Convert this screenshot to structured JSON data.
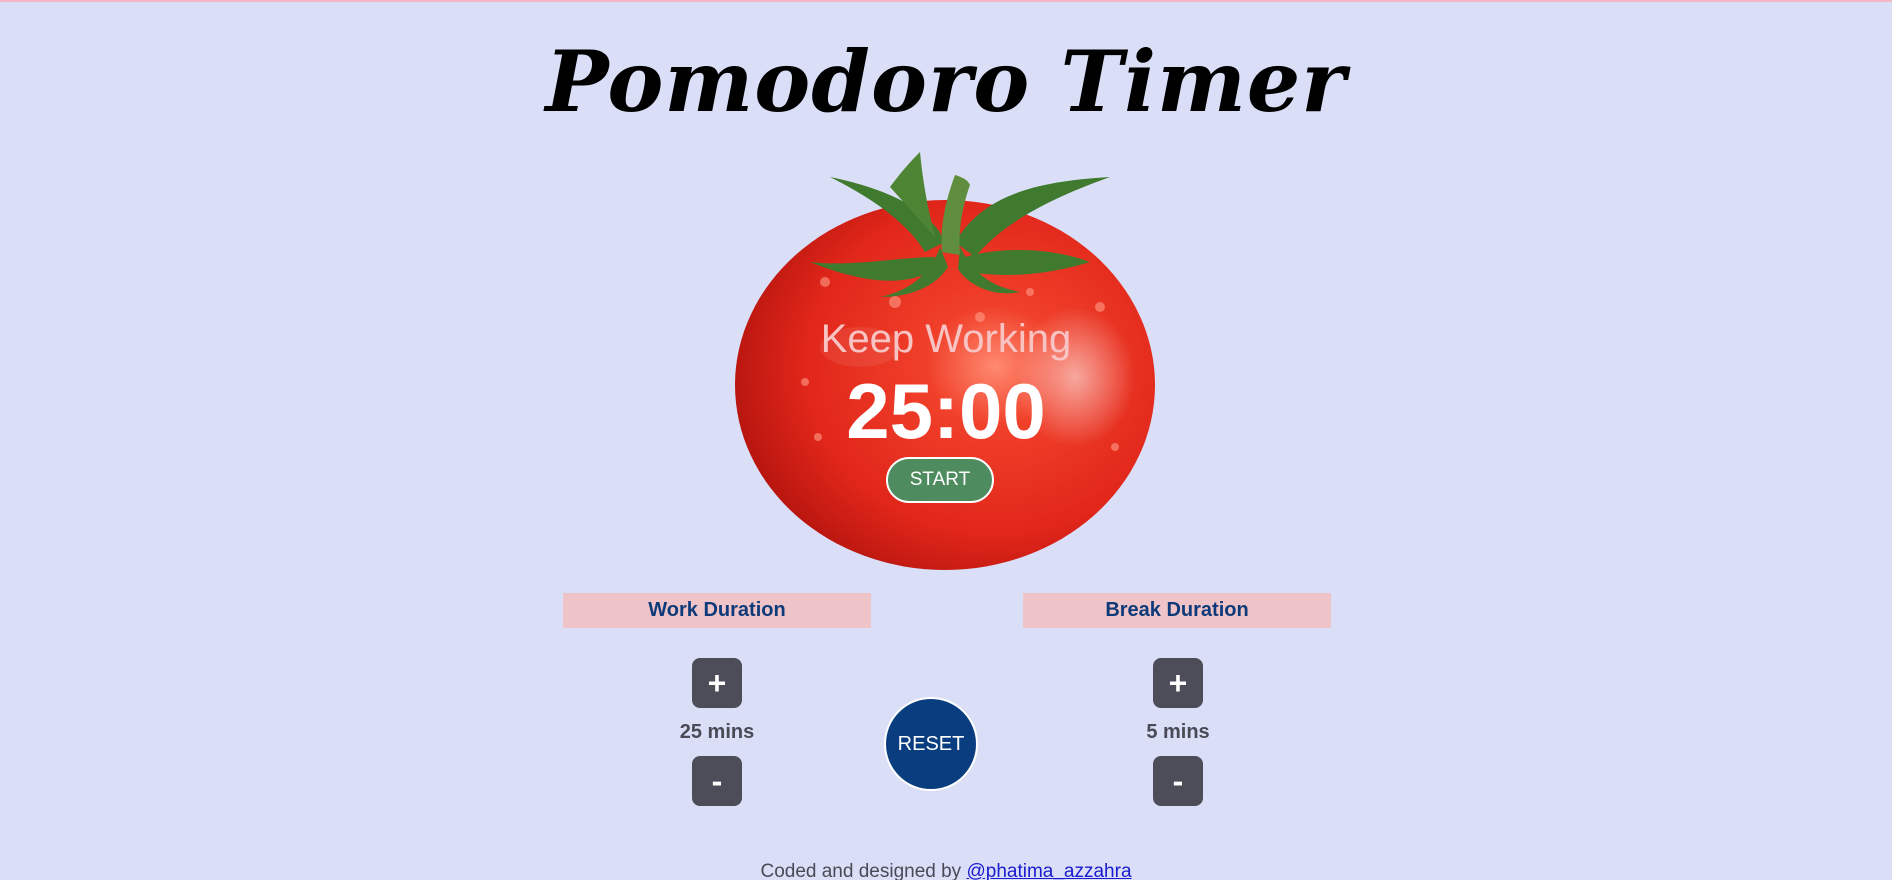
{
  "title": "Pomodoro Timer",
  "timer": {
    "status_text": "Keep Working",
    "time": "25:00",
    "start_label": "START"
  },
  "work": {
    "label": "Work Duration",
    "plus_label": "+",
    "value": "25 mins",
    "minus_label": "-"
  },
  "break": {
    "label": "Break Duration",
    "plus_label": "+",
    "value": "5 mins",
    "minus_label": "-"
  },
  "reset_label": "RESET",
  "footer": {
    "text": "Coded and designed by",
    "link_text": "@phatima_azzahra"
  },
  "icons": {
    "tomato": "tomato-image"
  },
  "colors": {
    "background": "#dadff7",
    "start_button": "#4e8b5f",
    "reset_button": "#0a3d80",
    "duration_label_bg": "#efc4c8",
    "duration_label_text": "#0e3a7a",
    "control_button": "#4d4c59"
  }
}
